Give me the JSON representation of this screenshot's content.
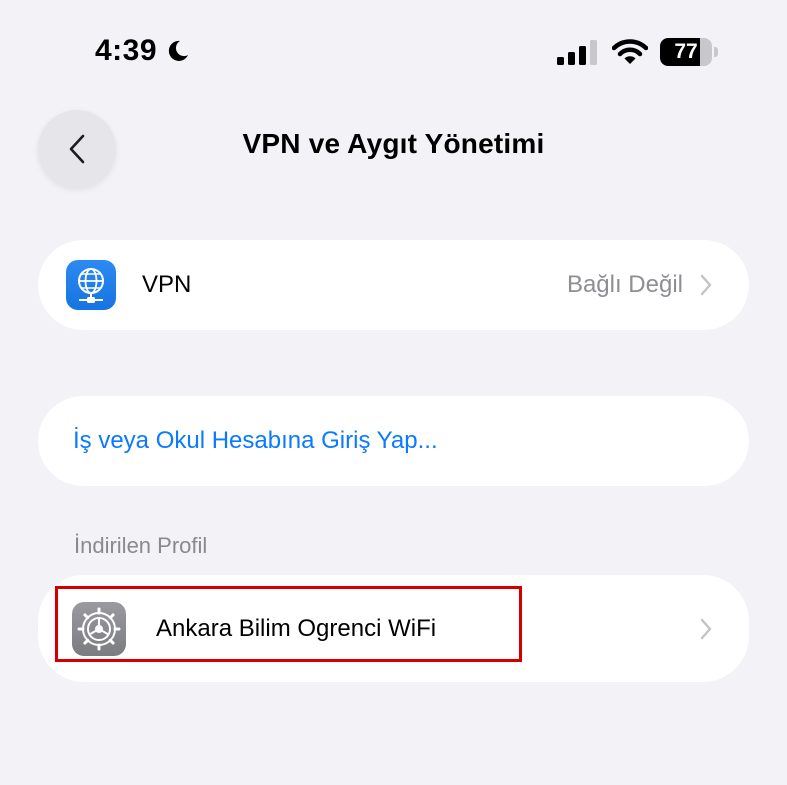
{
  "status_bar": {
    "time": "4:39",
    "battery_level": "77",
    "battery_fraction": 0.77,
    "icons": [
      "moon-icon",
      "signal-icon",
      "wifi-icon",
      "battery-icon"
    ]
  },
  "nav": {
    "back_icon": "chevron-left-icon",
    "title": "VPN ve Aygıt Yönetimi"
  },
  "vpn_row": {
    "icon": "globe-network-icon",
    "label": "VPN",
    "status": "Bağlı Değil"
  },
  "signin_row": {
    "label": "İş veya Okul Hesabına Giriş Yap..."
  },
  "downloaded_profile": {
    "section_header": "İndirilen Profil",
    "icon": "settings-gear-icon",
    "label": "Ankara Bilim Ogrenci WiFi"
  },
  "colors": {
    "background": "#f2f2f7",
    "card": "#ffffff",
    "link": "#0a7aff",
    "secondary_text": "#8e8e93",
    "highlight": "#d40000",
    "vpn_icon": "#1a7cf0"
  }
}
